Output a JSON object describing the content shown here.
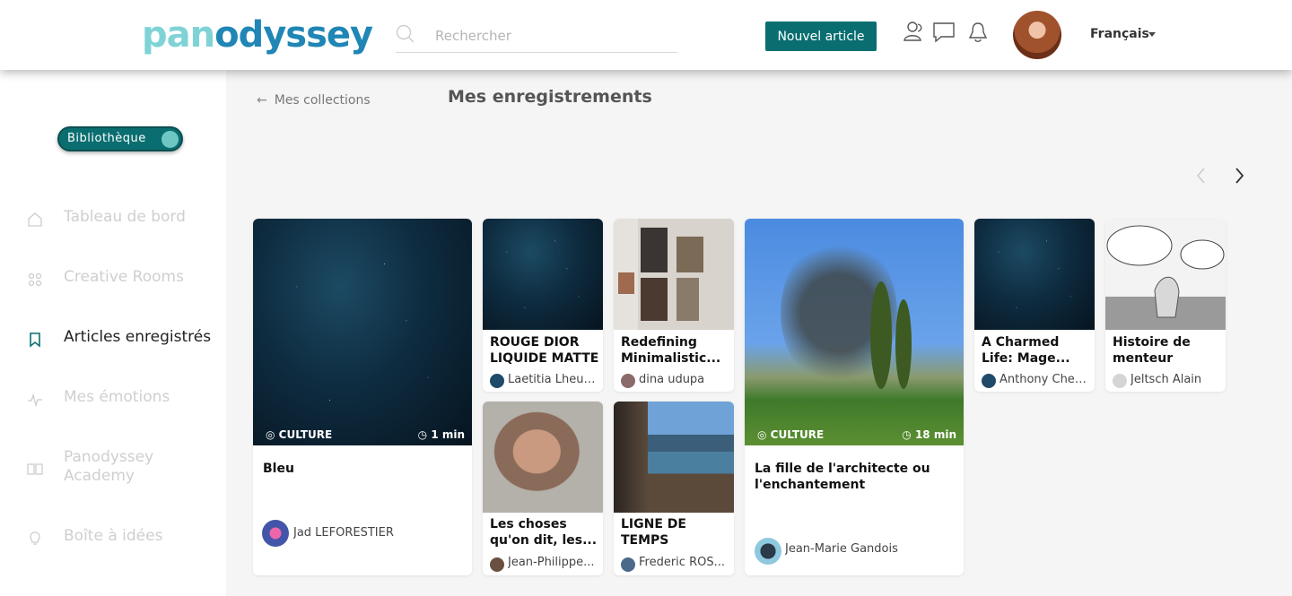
{
  "header": {
    "logo_part1": "pan",
    "logo_part2": "odyssey",
    "search_placeholder": "Rechercher",
    "new_article": "Nouvel article",
    "language": "Français"
  },
  "sidebar": {
    "toggle_label": "Bibliothèque",
    "items": [
      {
        "label": "Tableau de bord",
        "icon": "home-icon"
      },
      {
        "label": "Creative Rooms",
        "icon": "rooms-icon"
      },
      {
        "label": "Articles enregistrés",
        "icon": "bookmark-icon",
        "active": true
      },
      {
        "label": "Mes émotions",
        "icon": "pulse-icon"
      },
      {
        "label": "Panodyssey Academy",
        "icon": "book-icon"
      },
      {
        "label": "Boîte à idées",
        "icon": "lightbulb-icon"
      }
    ]
  },
  "main": {
    "back_label": "Mes collections",
    "title": "Mes enregistrements",
    "cards": [
      {
        "title": "Bleu",
        "author": "Jad LEFORESTIER",
        "tag": "CULTURE",
        "duration": "1 min"
      },
      {
        "title": "ROUGE DIOR LIQUIDE MATTE",
        "author": "Laetitia Lheur..."
      },
      {
        "title": "Redefining Minimalistic...",
        "author": "dina udupa"
      },
      {
        "title": "La fille de l'architecte ou l'enchantement",
        "author": "Jean-Marie Gandois",
        "tag": "CULTURE",
        "duration": "18 min"
      },
      {
        "title": "A Charmed Life: Mage...",
        "author": "Anthony Cher..."
      },
      {
        "title": "Histoire de menteur",
        "author": "Jeltsch Alain"
      },
      {
        "title": "Les choses qu'on dit, les...",
        "author": "Jean-Philippe..."
      },
      {
        "title": "LIGNE DE TEMPS",
        "author": "Frederic ROS..."
      }
    ]
  },
  "colors": {
    "accent": "#0a6e70",
    "logo_light": "#7fd3d6",
    "logo_dark": "#1f86b5"
  }
}
